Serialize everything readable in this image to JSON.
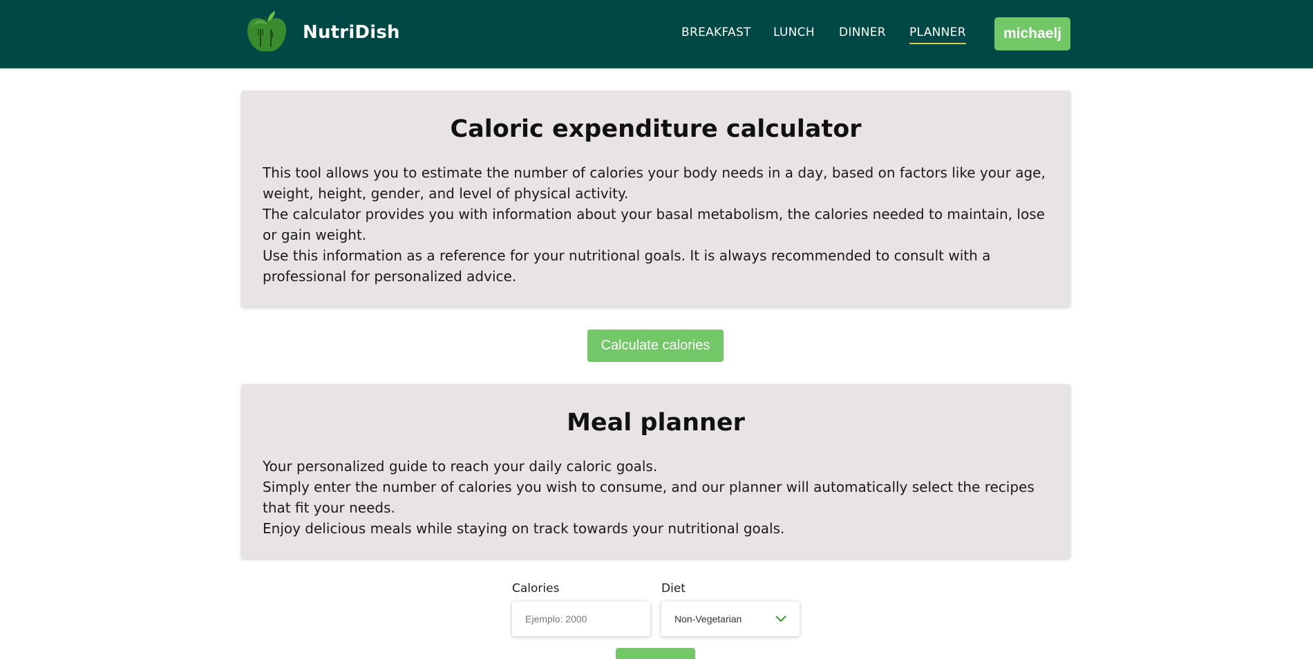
{
  "header": {
    "brand": "NutriDish",
    "logo_icon": "apple-fork-knife-logo",
    "nav": [
      {
        "label": "BREAKFAST",
        "active": false
      },
      {
        "label": "LUNCH",
        "active": false
      },
      {
        "label": "DINNER",
        "active": false
      },
      {
        "label": "PLANNER",
        "active": true
      }
    ],
    "user": "michaelj"
  },
  "calculator_card": {
    "title": "Caloric expenditure calculator",
    "paragraphs": [
      "This tool allows you to estimate the number of calories your body needs in a day, based on factors like your age, weight, height, gender, and level of physical activity.",
      "The calculator provides you with information about your basal metabolism, the calories needed to maintain, lose or gain weight.",
      "Use this information as a reference for your nutritional goals. It is always recommended to consult with a professional for personalized advice."
    ]
  },
  "calculate_button": "Calculate calories",
  "planner_card": {
    "title": "Meal planner",
    "paragraphs": [
      "Your personalized guide to reach your daily caloric goals.",
      "Simply enter the number of calories you wish to consume, and our planner will automatically select the recipes that fit your needs.",
      "Enjoy delicious meals while staying on track towards your nutritional goals."
    ]
  },
  "form": {
    "calories_label": "Calories",
    "calories_placeholder": "Ejemplo: 2000",
    "diet_label": "Diet",
    "diet_selected": "Non-Vegetarian"
  },
  "colors": {
    "header_bg": "#004845",
    "accent_green": "#72c767",
    "card_bg": "#e8e4e4",
    "active_underline": "#e6c84a"
  }
}
